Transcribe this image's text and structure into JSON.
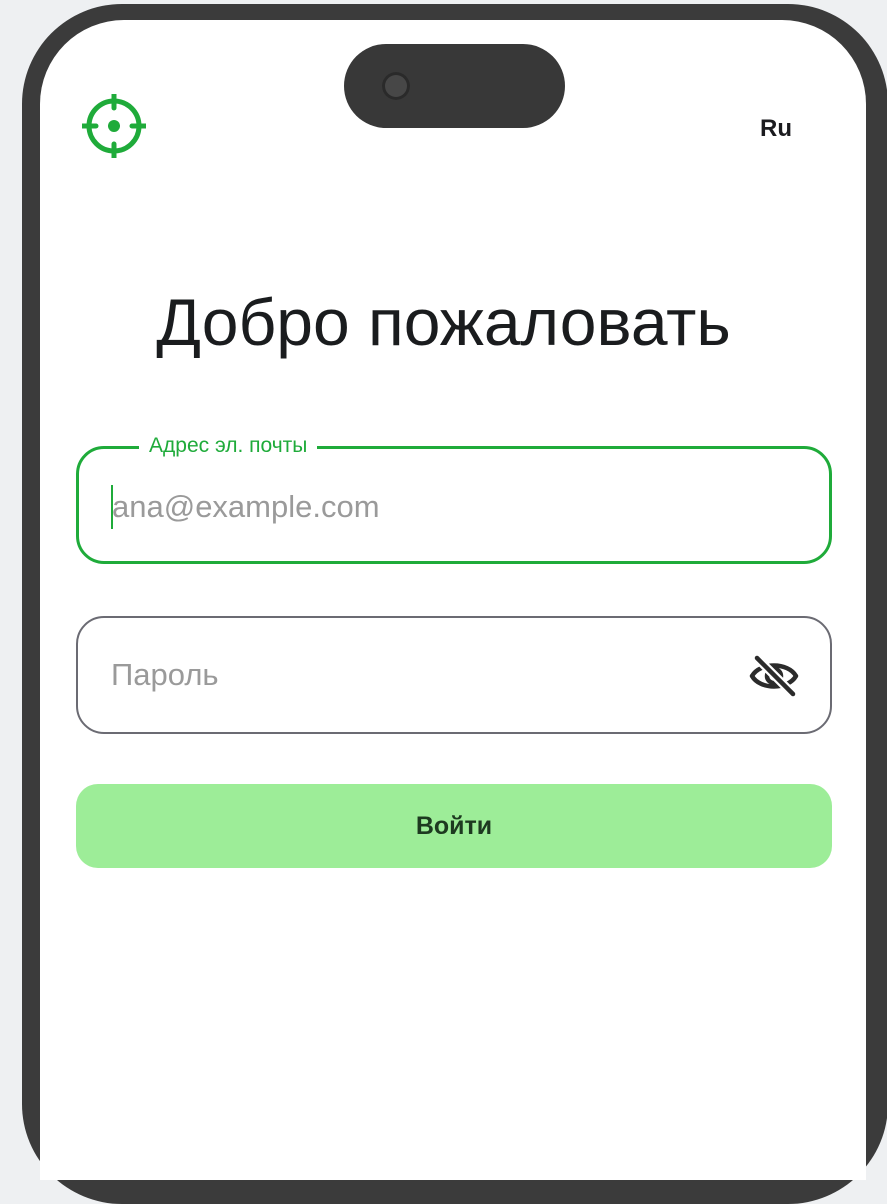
{
  "header": {
    "logo_icon": "crosshair-icon",
    "language": "Ru"
  },
  "title": "Добро пожаловать",
  "email": {
    "label": "Адрес эл. почты",
    "placeholder": "ana@example.com",
    "value": ""
  },
  "password": {
    "placeholder": "Пароль",
    "value": "",
    "toggle_icon": "eye-off-icon"
  },
  "login_button": {
    "label": "Войти"
  },
  "colors": {
    "accent": "#1fab3a",
    "button_bg": "#9ded98",
    "button_text": "#1d3a20",
    "frame": "#3b3b3b"
  }
}
